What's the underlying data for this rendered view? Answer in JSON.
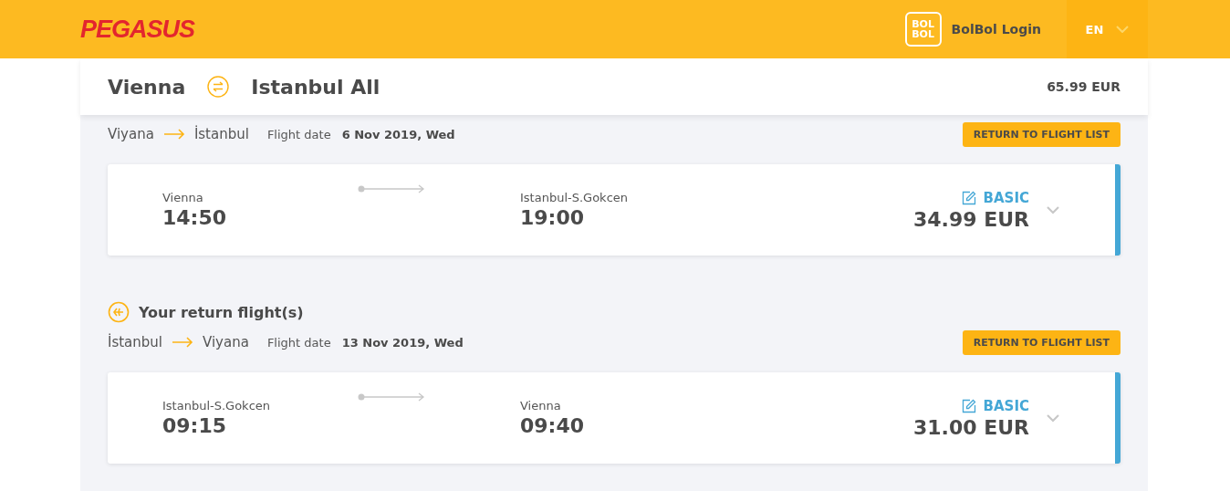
{
  "header": {
    "logo": "PEGASUS",
    "bolbol_badge": [
      "BOL",
      "BOL"
    ],
    "login": "BolBol Login",
    "language": "EN"
  },
  "summary": {
    "origin": "Vienna",
    "destination": "Istanbul All",
    "total": "65.99 EUR"
  },
  "legs": [
    {
      "from": "Viyana",
      "to": "İstanbul",
      "date_label": "Flight date",
      "date": "6 Nov 2019, Wed",
      "button": "RETURN TO FLIGHT LIST",
      "card": {
        "dep_city": "Vienna",
        "dep_time": "14:50",
        "arr_city": "Istanbul-S.Gokcen",
        "arr_time": "19:00",
        "fare": "BASIC",
        "price": "34.99 EUR",
        "expanded": false
      }
    },
    {
      "heading": "Your return flight(s)",
      "from": "İstanbul",
      "to": "Viyana",
      "date_label": "Flight date",
      "date": "13 Nov 2019, Wed",
      "button": "RETURN TO FLIGHT LIST",
      "card": {
        "dep_city": "Istanbul-S.Gokcen",
        "dep_time": "09:15",
        "arr_city": "Vienna",
        "arr_time": "09:40",
        "fare": "BASIC",
        "price": "31.00 EUR",
        "expanded": false
      }
    }
  ]
}
